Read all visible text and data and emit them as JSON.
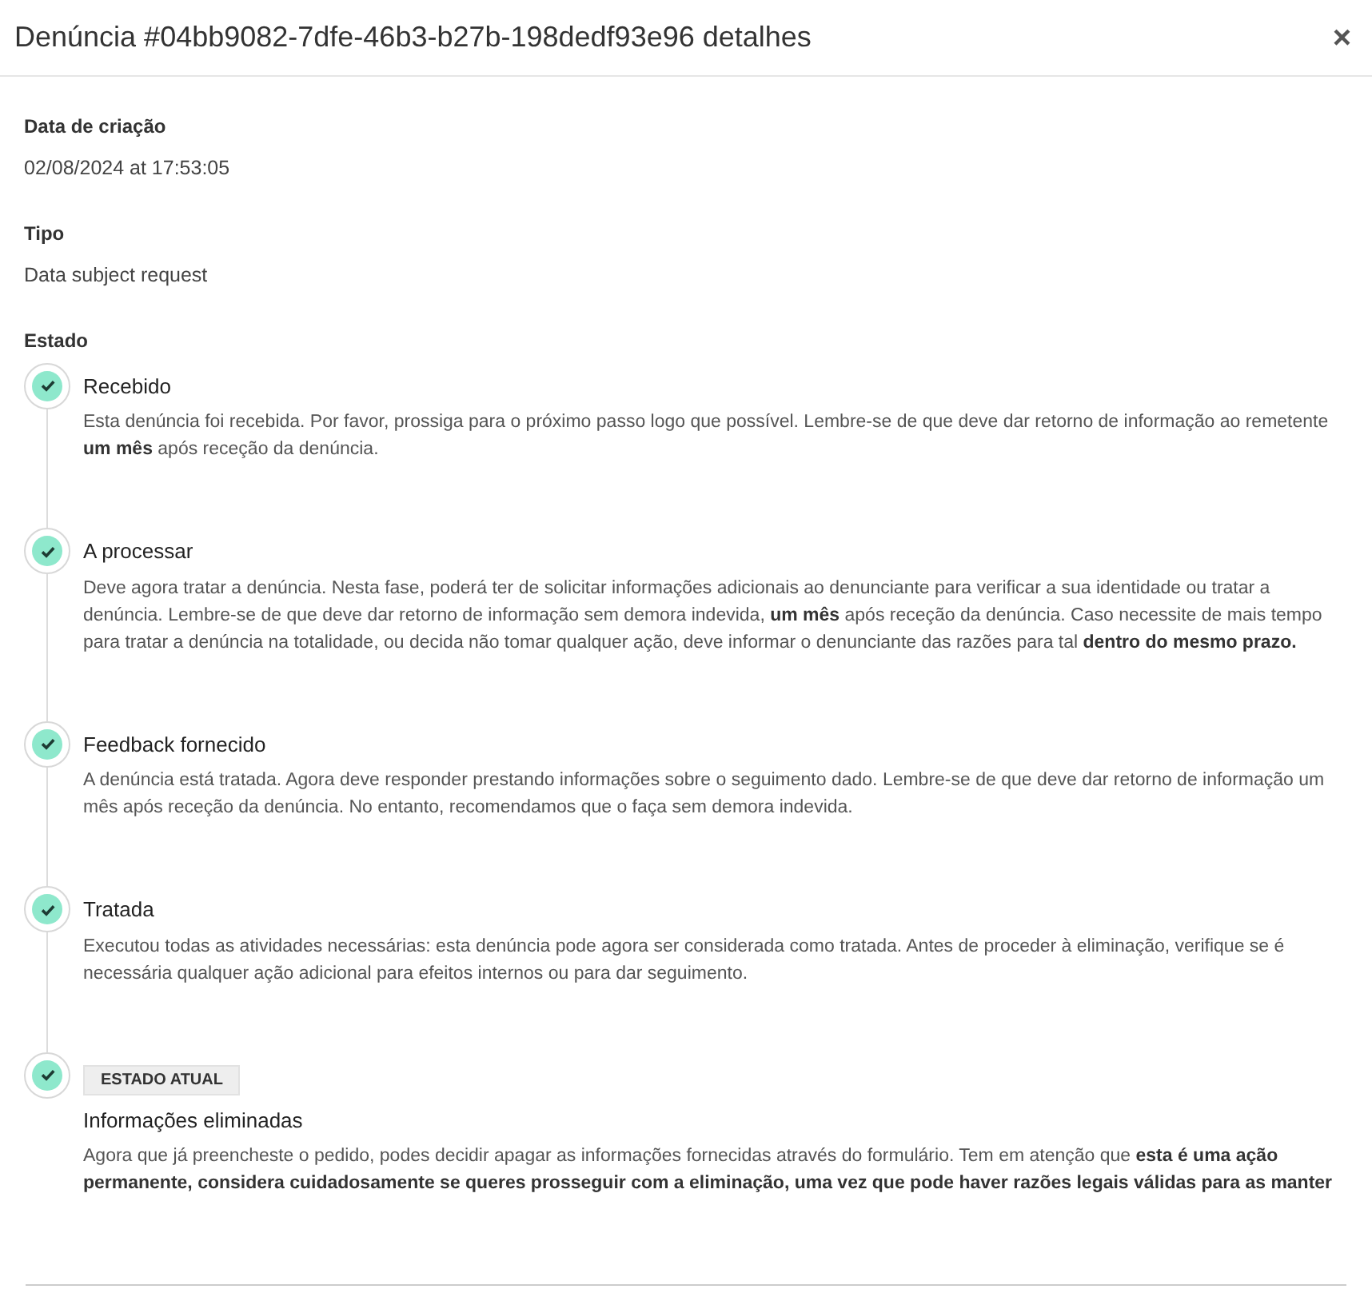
{
  "modal": {
    "title": "Denúncia #04bb9082-7dfe-46b3-b27b-198dedf93e96 detalhes",
    "close": "×"
  },
  "fields": [
    {
      "label": "Data de criação",
      "value": "02/08/2024 at 17:53:05"
    },
    {
      "label": "Tipo",
      "value": "Data subject request"
    }
  ],
  "status": {
    "label": "Estado",
    "steps": [
      {
        "title": "Recebido",
        "done": true,
        "description": "Esta denúncia foi recebida. Por favor, prossiga para o próximo passo logo que possível. Lembre-se de que deve dar retorno de informação ao remetente **um mês** após receção da denúncia."
      },
      {
        "title": "A processar",
        "done": true,
        "description": "Deve agora tratar a denúncia. Nesta fase, poderá ter de solicitar informações adicionais ao denunciante para verificar a sua identidade ou tratar a denúncia. Lembre-se de que deve dar retorno de informação sem demora indevida, **um mês** após receção da denúncia. Caso necessite de mais tempo para tratar a denúncia na totalidade, ou decida não tomar qualquer ação, deve informar o denunciante das razões para tal **dentro do mesmo prazo.**"
      },
      {
        "title": "Feedback fornecido",
        "done": true,
        "description": "A denúncia está tratada. Agora deve responder prestando informações sobre o seguimento dado. Lembre-se de que deve dar retorno de informação um mês após receção da denúncia. No entanto, recomendamos que o faça sem demora indevida."
      },
      {
        "title": "Tratada",
        "done": true,
        "description": "Executou todas as atividades necessárias: esta denúncia pode agora ser considerada como tratada. Antes de proceder à eliminação, verifique se é necessária qualquer ação adicional para efeitos internos ou para dar seguimento."
      },
      {
        "title": "Informações eliminadas",
        "done": true,
        "badge": "ESTADO ATUAL",
        "description": "Agora que já preencheste o pedido, podes decidir apagar as informações fornecidas através do formulário. Tem em atenção que **esta é uma ação permanente, considera cuidadosamente se queres prosseguir com a eliminação, uma vez que pode haver razões legais válidas para as manter**"
      }
    ]
  }
}
